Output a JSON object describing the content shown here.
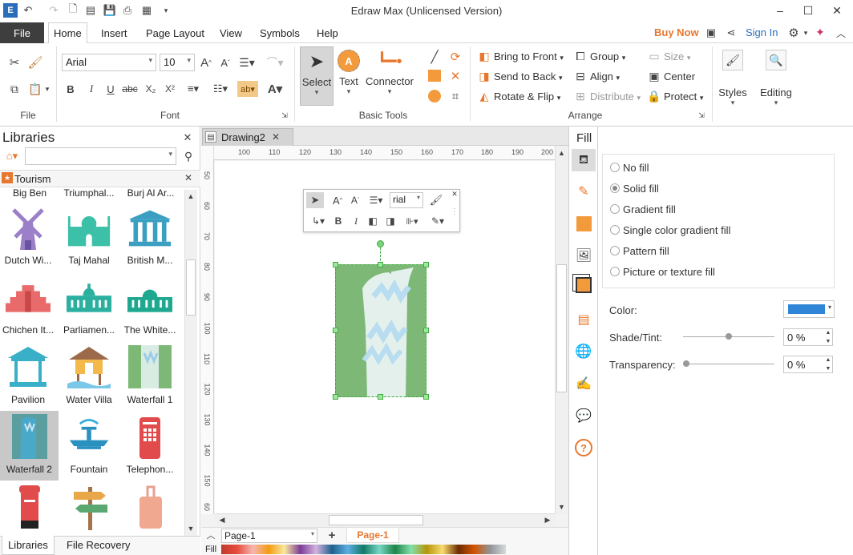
{
  "app": {
    "title": "Edraw Max (Unlicensed Version)",
    "buy_now": "Buy Now",
    "sign_in": "Sign In"
  },
  "menu": {
    "file": "File",
    "tabs": [
      "Home",
      "Insert",
      "Page Layout",
      "View",
      "Symbols",
      "Help"
    ]
  },
  "ribbon": {
    "font": {
      "name": "Arial",
      "size": "10",
      "group_label": "Font"
    },
    "file_group_label": "File",
    "basic_tools": {
      "select": "Select",
      "text": "Text",
      "connector": "Connector",
      "group_label": "Basic Tools"
    },
    "arrange": {
      "bring_to_front": "Bring to Front",
      "send_to_back": "Send to Back",
      "rotate_flip": "Rotate & Flip",
      "group": "Group",
      "align": "Align",
      "distribute": "Distribute",
      "size": "Size",
      "center": "Center",
      "protect": "Protect",
      "group_label": "Arrange"
    },
    "styles": "Styles",
    "editing": "Editing"
  },
  "libraries": {
    "title": "Libraries",
    "category": "Tourism",
    "top_row": [
      "Big Ben",
      "Triumphal...",
      "Burj Al Ar..."
    ],
    "shapes": [
      {
        "label": "Dutch Wi...",
        "icon": "windmill-icon"
      },
      {
        "label": "Taj Mahal",
        "icon": "taj-mahal-icon"
      },
      {
        "label": "British M...",
        "icon": "museum-icon"
      },
      {
        "label": "Chichen It...",
        "icon": "pyramid-icon"
      },
      {
        "label": "Parliamen...",
        "icon": "parliament-icon"
      },
      {
        "label": "The White...",
        "icon": "white-house-icon"
      },
      {
        "label": "Pavilion",
        "icon": "pavilion-icon"
      },
      {
        "label": "Water Villa",
        "icon": "water-villa-icon"
      },
      {
        "label": "Waterfall 1",
        "icon": "waterfall-icon"
      },
      {
        "label": "Waterfall 2",
        "icon": "waterfall-icon"
      },
      {
        "label": "Fountain",
        "icon": "fountain-icon"
      },
      {
        "label": "Telephon...",
        "icon": "telephone-booth-icon"
      }
    ],
    "bottom_tabs": [
      "Libraries",
      "File Recovery"
    ]
  },
  "document": {
    "tab": "Drawing2",
    "ruler_h": [
      "100",
      "110",
      "120",
      "130",
      "140",
      "150",
      "160",
      "170",
      "180",
      "190",
      "200"
    ],
    "ruler_v": [
      "50",
      "60",
      "70",
      "80",
      "90",
      "100",
      "110",
      "120",
      "130",
      "140",
      "150",
      "60"
    ],
    "page_select": "Page-1",
    "page_tab": "Page-1",
    "fill_label": "Fill",
    "mini_font": "rial"
  },
  "fill_panel": {
    "title": "Fill",
    "options": [
      "No fill",
      "Solid fill",
      "Gradient fill",
      "Single color gradient fill",
      "Pattern fill",
      "Picture or texture fill"
    ],
    "selected": "Solid fill",
    "color_label": "Color:",
    "color_value": "#2f86d6",
    "shade_label": "Shade/Tint:",
    "shade_value": "0 %",
    "transparency_label": "Transparency:",
    "transparency_value": "0 %"
  },
  "colors": {
    "accent_orange": "#e8772e",
    "waterfall_green": "#7db877",
    "shape_green": "#5aa8a0"
  }
}
